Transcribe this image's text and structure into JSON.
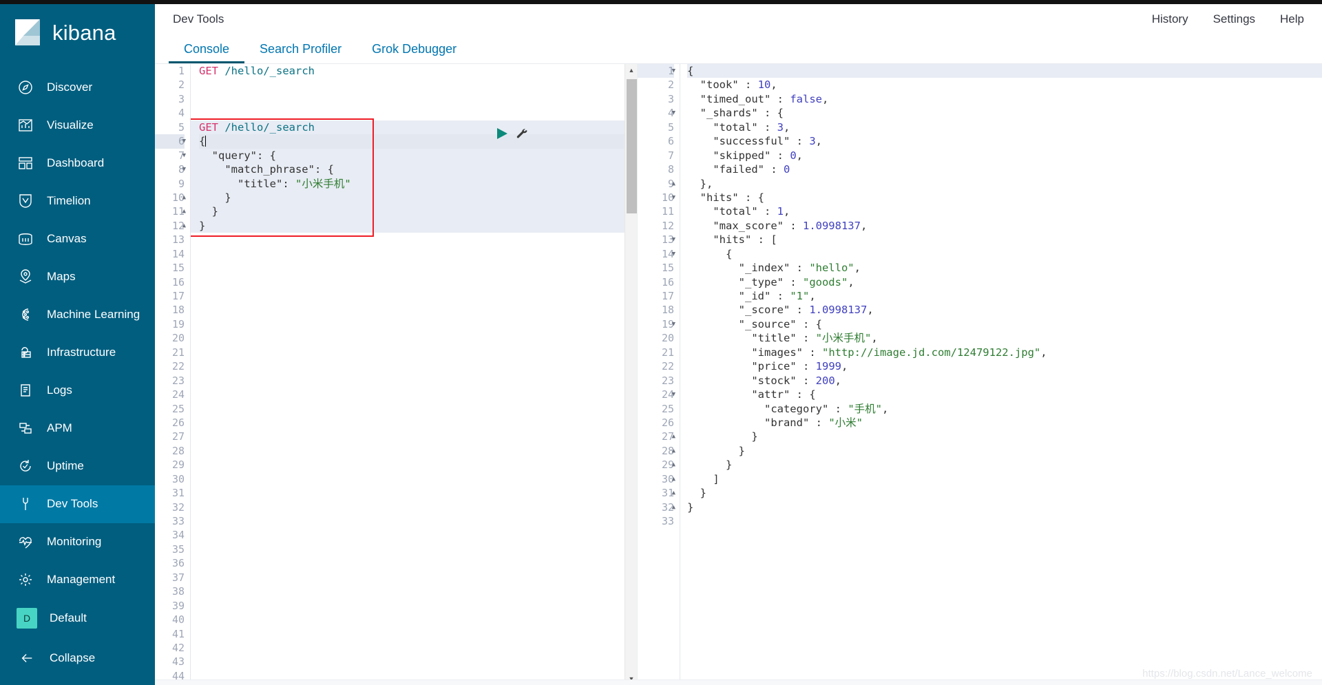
{
  "app": {
    "name": "kibana"
  },
  "header": {
    "title": "Dev Tools",
    "links": [
      {
        "label": "History"
      },
      {
        "label": "Settings"
      },
      {
        "label": "Help"
      }
    ]
  },
  "tabs": [
    {
      "label": "Console",
      "active": true
    },
    {
      "label": "Search Profiler",
      "active": false
    },
    {
      "label": "Grok Debugger",
      "active": false
    }
  ],
  "sidebar": {
    "items": [
      {
        "label": "Discover",
        "icon": "compass-icon",
        "active": false
      },
      {
        "label": "Visualize",
        "icon": "bar-chart-icon",
        "active": false
      },
      {
        "label": "Dashboard",
        "icon": "dashboard-icon",
        "active": false
      },
      {
        "label": "Timelion",
        "icon": "timelion-icon",
        "active": false
      },
      {
        "label": "Canvas",
        "icon": "canvas-icon",
        "active": false
      },
      {
        "label": "Maps",
        "icon": "map-pin-icon",
        "active": false
      },
      {
        "label": "Machine Learning",
        "icon": "machine-learning-icon",
        "active": false
      },
      {
        "label": "Infrastructure",
        "icon": "infrastructure-icon",
        "active": false
      },
      {
        "label": "Logs",
        "icon": "logs-icon",
        "active": false
      },
      {
        "label": "APM",
        "icon": "apm-icon",
        "active": false
      },
      {
        "label": "Uptime",
        "icon": "uptime-icon",
        "active": false
      },
      {
        "label": "Dev Tools",
        "icon": "wrench-icon",
        "active": true
      },
      {
        "label": "Monitoring",
        "icon": "heartbeat-icon",
        "active": false
      },
      {
        "label": "Management",
        "icon": "gear-icon",
        "active": false
      }
    ],
    "space": {
      "label": "Default",
      "badge": "D"
    },
    "collapse": {
      "label": "Collapse",
      "icon": "arrow-left-icon"
    }
  },
  "editor": {
    "request_lines": [
      {
        "n": 1,
        "text": "GET /hello/_search",
        "type": "request"
      },
      {
        "n": 2,
        "text": "",
        "type": "blank"
      },
      {
        "n": 3,
        "text": "",
        "type": "blank"
      },
      {
        "n": 4,
        "text": "",
        "type": "blank"
      },
      {
        "n": 5,
        "text": "GET /hello/_search",
        "type": "request"
      },
      {
        "n": 6,
        "text": "{",
        "type": "json",
        "fold": "open",
        "highlight": true
      },
      {
        "n": 7,
        "text": "  \"query\": {",
        "type": "json",
        "fold": "open"
      },
      {
        "n": 8,
        "text": "    \"match_phrase\": {",
        "type": "json",
        "fold": "open"
      },
      {
        "n": 9,
        "text": "      \"title\": \"小米手机\"",
        "type": "json"
      },
      {
        "n": 10,
        "text": "    }",
        "type": "json",
        "fold": "close"
      },
      {
        "n": 11,
        "text": "  }",
        "type": "json",
        "fold": "close"
      },
      {
        "n": 12,
        "text": "}",
        "type": "json",
        "fold": "close"
      }
    ],
    "blank_line_start": 13,
    "blank_line_end": 44,
    "run_button": "▶",
    "wrench_button": "wrench-icon"
  },
  "response": {
    "lines": [
      {
        "n": 1,
        "text": "{",
        "fold": "open",
        "highlight": true
      },
      {
        "n": 2,
        "text": "  \"took\" : 10,"
      },
      {
        "n": 3,
        "text": "  \"timed_out\" : false,"
      },
      {
        "n": 4,
        "text": "  \"_shards\" : {",
        "fold": "open"
      },
      {
        "n": 5,
        "text": "    \"total\" : 3,"
      },
      {
        "n": 6,
        "text": "    \"successful\" : 3,"
      },
      {
        "n": 7,
        "text": "    \"skipped\" : 0,"
      },
      {
        "n": 8,
        "text": "    \"failed\" : 0"
      },
      {
        "n": 9,
        "text": "  },",
        "fold": "close"
      },
      {
        "n": 10,
        "text": "  \"hits\" : {",
        "fold": "open"
      },
      {
        "n": 11,
        "text": "    \"total\" : 1,"
      },
      {
        "n": 12,
        "text": "    \"max_score\" : 1.0998137,"
      },
      {
        "n": 13,
        "text": "    \"hits\" : [",
        "fold": "open"
      },
      {
        "n": 14,
        "text": "      {",
        "fold": "open"
      },
      {
        "n": 15,
        "text": "        \"_index\" : \"hello\","
      },
      {
        "n": 16,
        "text": "        \"_type\" : \"goods\","
      },
      {
        "n": 17,
        "text": "        \"_id\" : \"1\","
      },
      {
        "n": 18,
        "text": "        \"_score\" : 1.0998137,"
      },
      {
        "n": 19,
        "text": "        \"_source\" : {",
        "fold": "open"
      },
      {
        "n": 20,
        "text": "          \"title\" : \"小米手机\","
      },
      {
        "n": 21,
        "text": "          \"images\" : \"http://image.jd.com/12479122.jpg\","
      },
      {
        "n": 22,
        "text": "          \"price\" : 1999,"
      },
      {
        "n": 23,
        "text": "          \"stock\" : 200,"
      },
      {
        "n": 24,
        "text": "          \"attr\" : {",
        "fold": "open"
      },
      {
        "n": 25,
        "text": "            \"category\" : \"手机\","
      },
      {
        "n": 26,
        "text": "            \"brand\" : \"小米\""
      },
      {
        "n": 27,
        "text": "          }",
        "fold": "close"
      },
      {
        "n": 28,
        "text": "        }",
        "fold": "close"
      },
      {
        "n": 29,
        "text": "      }",
        "fold": "close"
      },
      {
        "n": 30,
        "text": "    ]",
        "fold": "close"
      },
      {
        "n": 31,
        "text": "  }",
        "fold": "close"
      },
      {
        "n": 32,
        "text": "}",
        "fold": "close"
      },
      {
        "n": 33,
        "text": ""
      }
    ]
  },
  "annotation": {
    "type": "red-rectangle",
    "covers_lines": "5-12"
  },
  "watermark": {
    "text": "https://blog.csdn.net/Lance_welcome"
  },
  "colors": {
    "sidebar_bg": "#015e7f",
    "sidebar_active": "#0179a5",
    "tab_link": "#0076b1",
    "tab_underline": "#00566e",
    "space_badge": "#48d4c4",
    "annotation": "#ee1c25",
    "run_button": "#0b8a7a",
    "string": "#2f7d32",
    "number": "#4040c0",
    "method": "#d6336c",
    "path": "#0b7285"
  }
}
